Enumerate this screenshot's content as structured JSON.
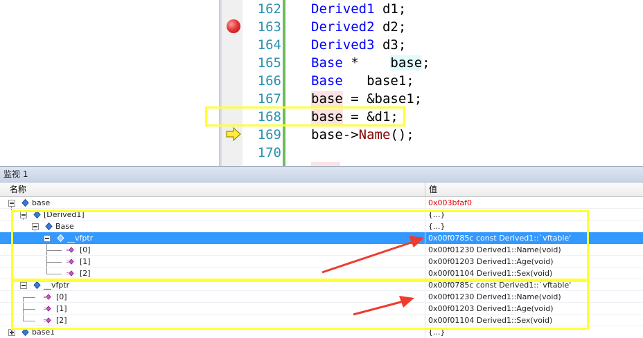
{
  "editor": {
    "lines": [
      {
        "num": "162",
        "parts": [
          {
            "t": "Derived1",
            "c": "kw"
          },
          {
            "t": " d1;"
          }
        ]
      },
      {
        "num": "163",
        "parts": [
          {
            "t": "Derived2",
            "c": "kw"
          },
          {
            "t": " d2;"
          }
        ]
      },
      {
        "num": "164",
        "parts": [
          {
            "t": "Derived3",
            "c": "kw"
          },
          {
            "t": " d3;"
          }
        ]
      },
      {
        "num": "165",
        "parts": [
          {
            "t": "Base",
            "c": "kw"
          },
          {
            "t": " *    "
          },
          {
            "t": "base",
            "c": "cyan"
          },
          {
            "t": ";"
          }
        ]
      },
      {
        "num": "166",
        "parts": [
          {
            "t": "Base",
            "c": "kw"
          },
          {
            "t": "   base1;"
          }
        ]
      },
      {
        "num": "167",
        "parts": [
          {
            "t": "base",
            "c": "pink"
          },
          {
            "t": " = &base1;"
          }
        ]
      },
      {
        "num": "168",
        "parts": [
          {
            "t": "base",
            "c": "pink"
          },
          {
            "t": " = &d1;"
          }
        ]
      },
      {
        "num": "169",
        "parts": [
          {
            "t": "base->"
          },
          {
            "t": "Name",
            "c": "fn"
          },
          {
            "t": "();"
          }
        ]
      },
      {
        "num": "170",
        "parts": []
      }
    ],
    "breakpoint_line": "163",
    "current_line": "169",
    "highlighted_line": "168"
  },
  "watch": {
    "title": "监视 1",
    "col_name": "名称",
    "col_value": "值",
    "rows": [
      {
        "name": "base",
        "value": "0x003bfaf0",
        "value_color": "red"
      },
      {
        "name": "[Derived1]",
        "value": "{...}"
      },
      {
        "name": "Base",
        "value": "{...}"
      },
      {
        "name": "__vfptr",
        "value": "0x00f0785c const Derived1::`vftable'"
      },
      {
        "name": "[0]",
        "value": "0x00f01230 Derived1::Name(void)"
      },
      {
        "name": "[1]",
        "value": "0x00f01203 Derived1::Age(void)"
      },
      {
        "name": "[2]",
        "value": "0x00f01104 Derived1::Sex(void)"
      },
      {
        "name": "__vfptr",
        "value": "0x00f0785c const Derived1::`vftable'"
      },
      {
        "name": "[0]",
        "value": "0x00f01230 Derived1::Name(void)"
      },
      {
        "name": "[1]",
        "value": "0x00f01203 Derived1::Age(void)"
      },
      {
        "name": "[2]",
        "value": "0x00f01104 Derived1::Sex(void)"
      },
      {
        "name": "base1",
        "value": "{...}"
      }
    ]
  },
  "colors": {
    "selection": "#3399ff",
    "annotation_box": "#ffff33",
    "annotation_arrow": "#ee3b2e",
    "keyword": "#0000ff",
    "line_number": "#2b91af"
  }
}
